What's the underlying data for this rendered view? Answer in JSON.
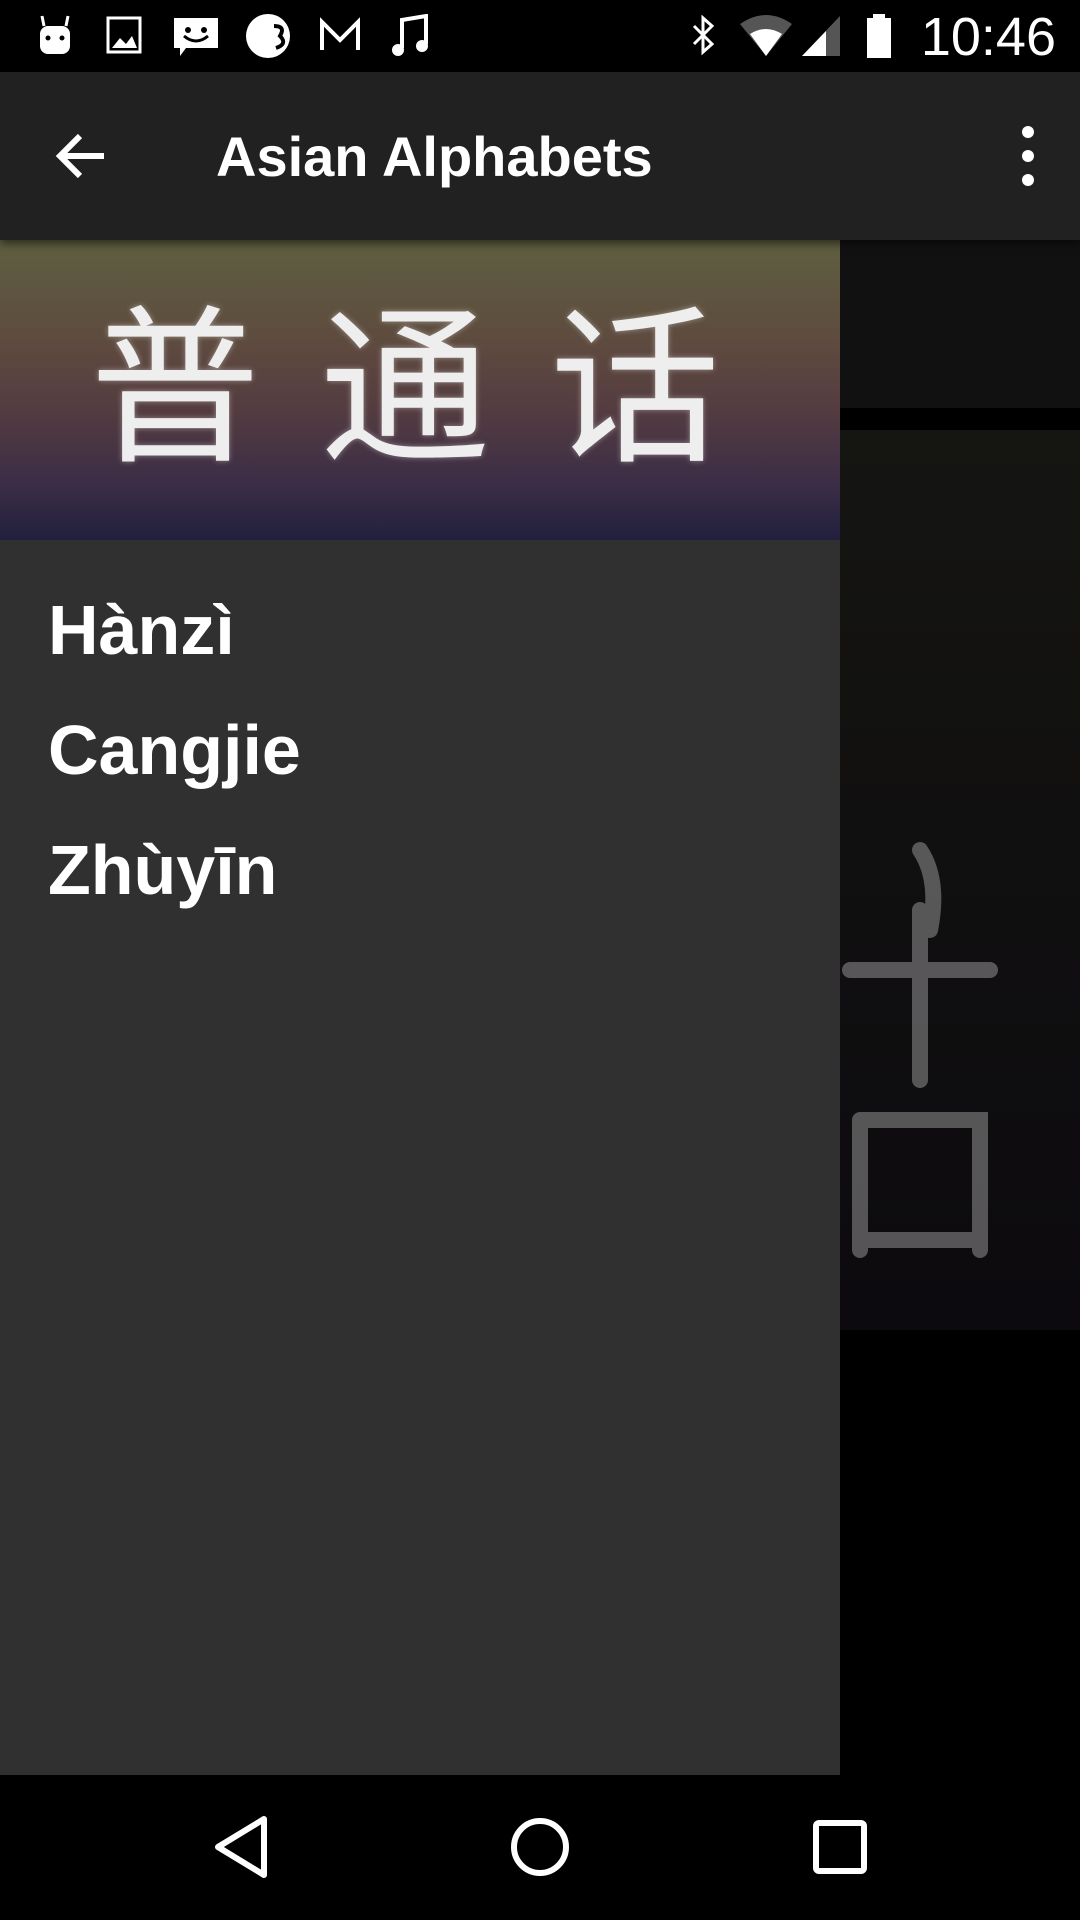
{
  "status_bar": {
    "left_icons": [
      "android-icon",
      "image-icon",
      "chat-icon",
      "crescent-app-icon",
      "gmail-icon",
      "music-note-icon"
    ],
    "right_icons": [
      "bluetooth-icon",
      "wifi-icon",
      "signal-icon",
      "battery-icon"
    ],
    "time": "10:46"
  },
  "toolbar": {
    "title": "Asian Alphabets",
    "back_icon": "arrow-back-icon",
    "menu_icon": "more-vert-icon"
  },
  "drawer": {
    "header_image_text": "普通话",
    "items": [
      {
        "label": "Hànzì"
      },
      {
        "label": "Cangjie"
      },
      {
        "label": "Zhùyīn"
      }
    ]
  },
  "nav_bar": {
    "buttons": [
      "back-triangle-icon",
      "home-circle-icon",
      "recents-square-icon"
    ]
  }
}
